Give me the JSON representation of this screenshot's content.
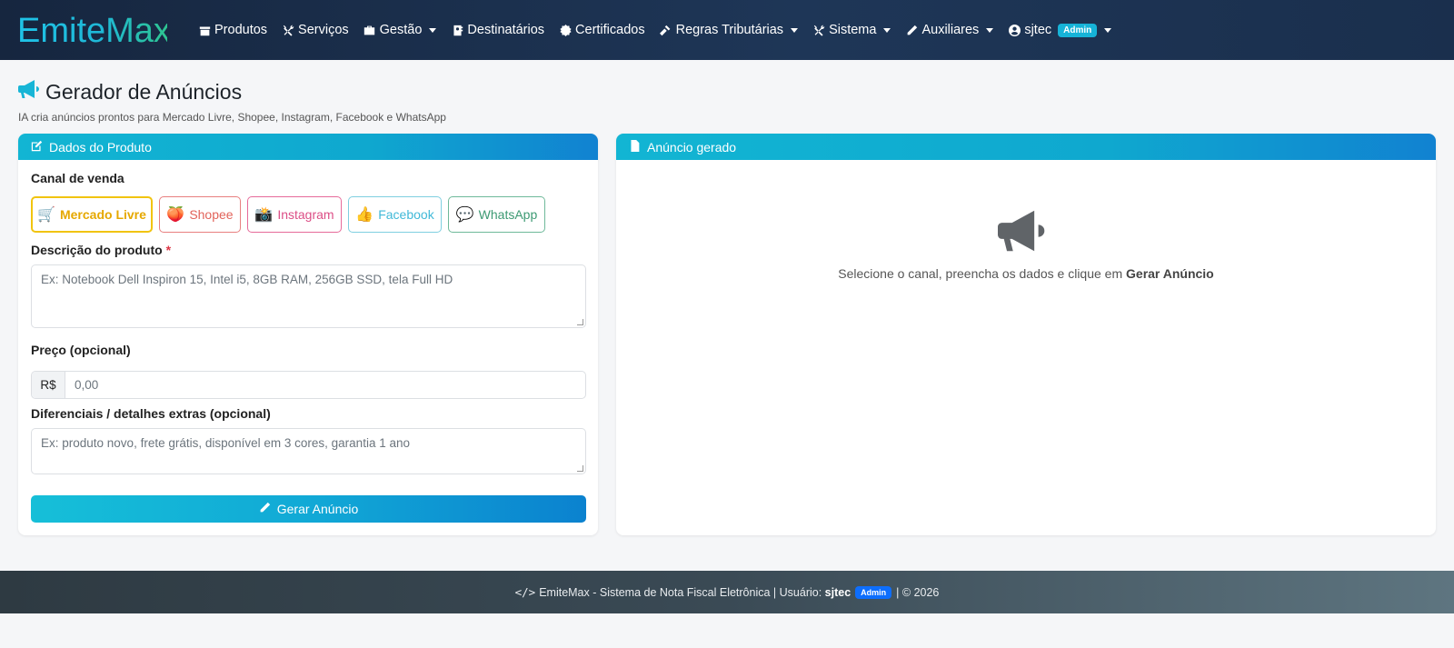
{
  "brand": {
    "name": "EmiteMax"
  },
  "nav": {
    "items": [
      {
        "label": "Produtos",
        "icon": "box-icon",
        "dropdown": false
      },
      {
        "label": "Serviços",
        "icon": "tools-icon",
        "dropdown": false
      },
      {
        "label": "Gestão",
        "icon": "briefcase-icon",
        "dropdown": true
      },
      {
        "label": "Destinatários",
        "icon": "address-book-icon",
        "dropdown": false
      },
      {
        "label": "Certificados",
        "icon": "certificate-icon",
        "dropdown": false
      },
      {
        "label": "Regras Tributárias",
        "icon": "gavel-icon",
        "dropdown": true
      },
      {
        "label": "Sistema",
        "icon": "tools-icon",
        "dropdown": true
      },
      {
        "label": "Auxiliares",
        "icon": "pen-icon",
        "dropdown": true
      }
    ],
    "user": {
      "name": "sjtec",
      "role": "Admin"
    }
  },
  "header": {
    "title": "Gerador de Anúncios",
    "subtitle": "IA cria anúncios prontos para Mercado Livre, Shopee, Instagram, Facebook e WhatsApp"
  },
  "left_card": {
    "title": "Dados do Produto",
    "channel_label": "Canal de venda",
    "channels": [
      {
        "label": "Mercado Livre",
        "emoji": "🛒",
        "selected": true
      },
      {
        "label": "Shopee",
        "emoji": "🍑",
        "selected": false
      },
      {
        "label": "Instagram",
        "emoji": "📸",
        "selected": false
      },
      {
        "label": "Facebook",
        "emoji": "👍",
        "selected": false
      },
      {
        "label": "WhatsApp",
        "emoji": "💬",
        "selected": false
      }
    ],
    "description_label": "Descrição do produto",
    "description_required": "*",
    "description_placeholder": "Ex: Notebook Dell Inspiron 15, Intel i5, 8GB RAM, 256GB SSD, tela Full HD",
    "price_label": "Preço (opcional)",
    "price_prefix": "R$",
    "price_placeholder": "0,00",
    "extras_label": "Diferenciais / detalhes extras (opcional)",
    "extras_placeholder": "Ex: produto novo, frete grátis, disponível em 3 cores, garantia 1 ano",
    "generate_button": "Gerar Anúncio"
  },
  "right_card": {
    "title": "Anúncio gerado",
    "empty_text": "Selecione o canal, preencha os dados e clique em ",
    "empty_text_bold": "Gerar Anúncio"
  },
  "footer": {
    "text_before": "EmiteMax - Sistema de Nota Fiscal Eletrônica | Usuário: ",
    "user": "sjtec",
    "badge": "Admin",
    "text_after": "| © 2026"
  },
  "colors": {
    "navbar": "#16263f",
    "accent": "#17b5d6",
    "required": "#dc3545"
  }
}
